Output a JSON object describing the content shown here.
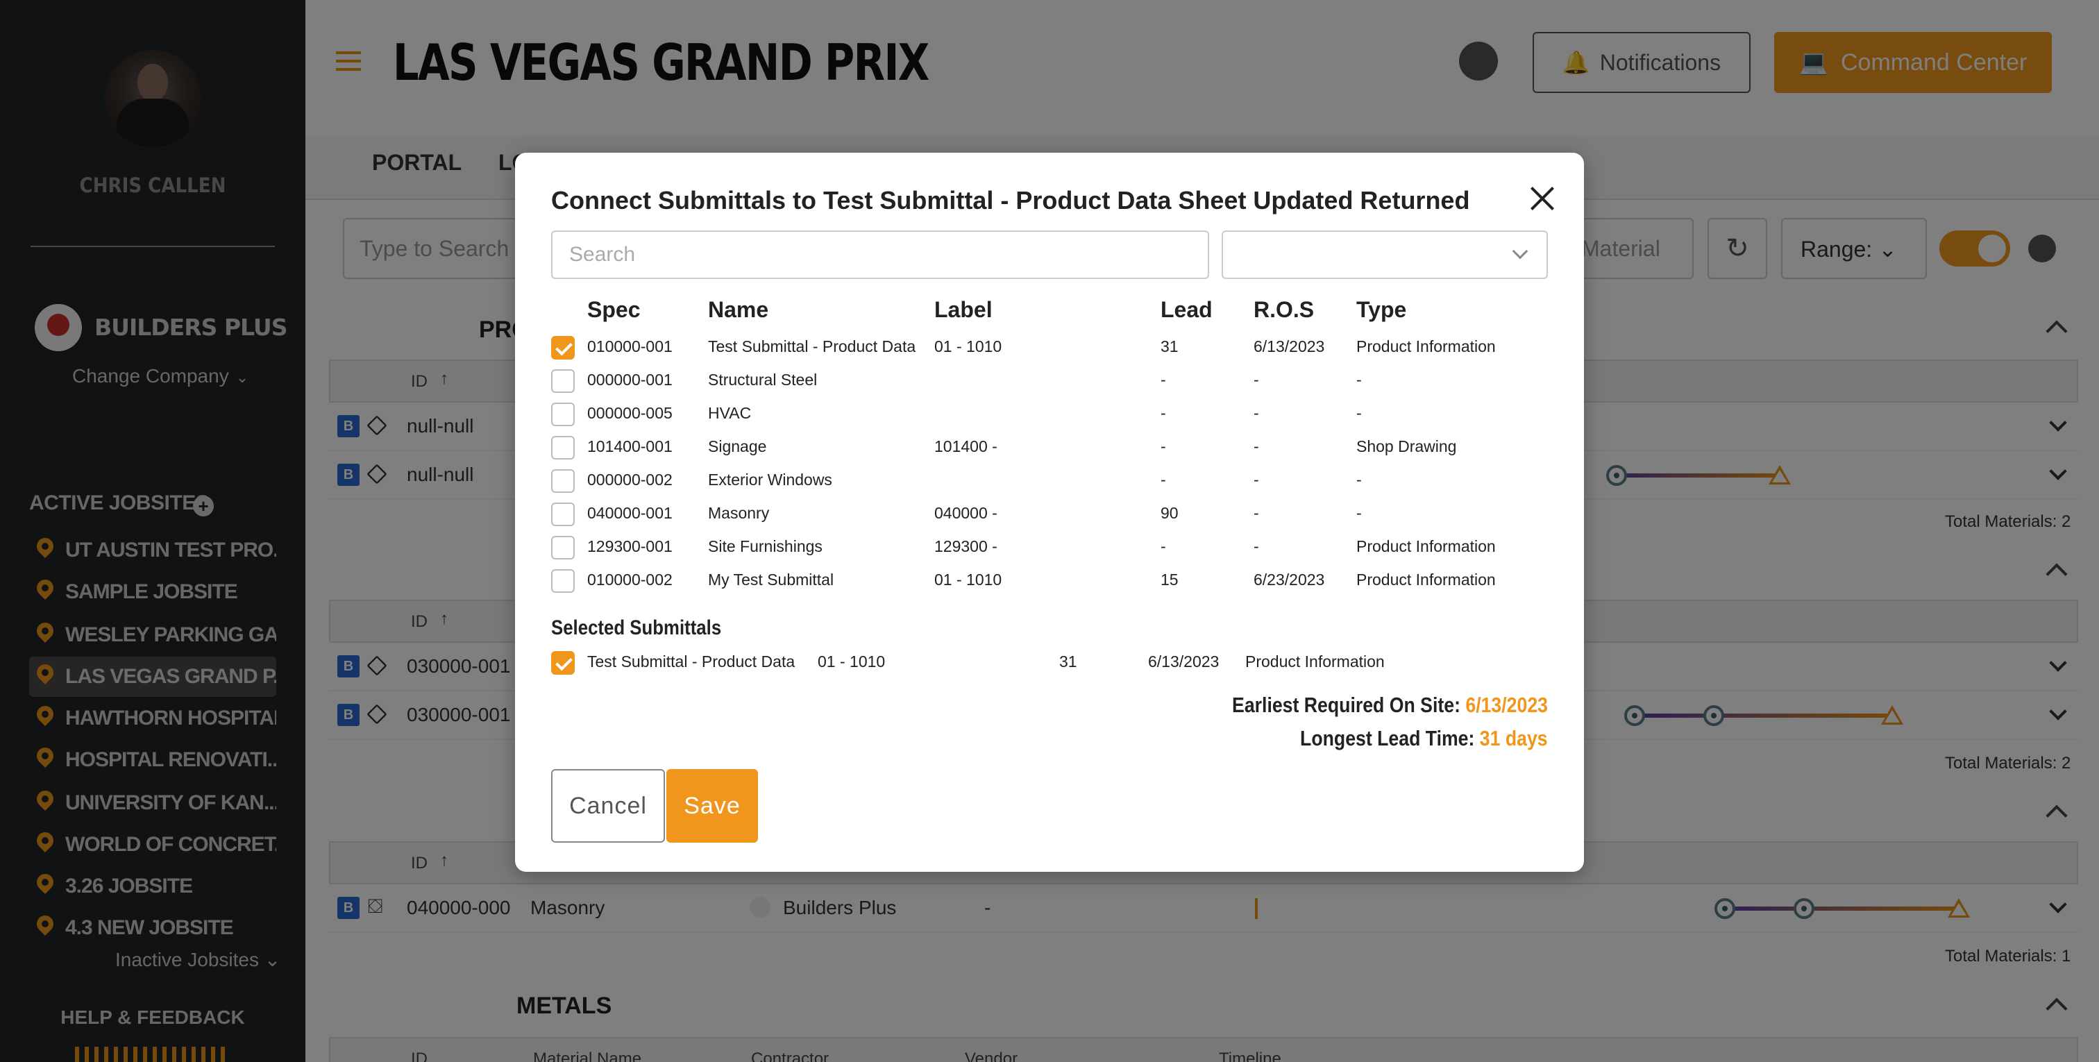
{
  "user": {
    "name": "CHRIS CALLEN"
  },
  "company": {
    "name": "BUILDERS PLUS",
    "change_label": "Change Company"
  },
  "sidebar": {
    "active_label": "ACTIVE JOBSITES",
    "jobsites": [
      "UT AUSTIN TEST PRO...",
      "SAMPLE JOBSITE",
      "WESLEY PARKING GA...",
      "LAS VEGAS GRAND P...",
      "HAWTHORN HOSPITAL",
      "HOSPITAL RENOVATI...",
      "UNIVERSITY OF KAN...",
      "WORLD OF CONCRET...",
      "3.26 JOBSITE",
      "4.3 NEW JOBSITE"
    ],
    "inactive_label": "Inactive Jobsites",
    "help_label": "HELP & FEEDBACK"
  },
  "header": {
    "title": "LAS VEGAS GRAND PRIX",
    "notifications_label": "Notifications",
    "command_center_label": "Command Center"
  },
  "tabs": [
    "PORTAL",
    "LO"
  ],
  "toolbar": {
    "search_placeholder": "Type to Search",
    "material_label": "Material",
    "range_label": "Range:"
  },
  "background": {
    "section_partial": "PRO",
    "id_header": "ID",
    "rows": {
      "r1": "null-null",
      "r2": "null-null",
      "r3": "030000-001",
      "r4": "030000-001",
      "r5_id": "040000-000",
      "r5_name": "Masonry",
      "r5_contractor": "Builders Plus",
      "r5_label": "-"
    },
    "totals": [
      "Total Materials: 2",
      "Total Materials: 2",
      "Total Materials: 1"
    ],
    "metals_section": "METALS",
    "metals_headers": [
      "ID",
      "Material Name",
      "Contractor",
      "Vendor",
      "Timeline"
    ]
  },
  "modal": {
    "title": "Connect Submittals to Test Submittal - Product Data Sheet Updated Returned",
    "search_placeholder": "Search",
    "columns": [
      "Spec",
      "Name",
      "Label",
      "Lead",
      "R.O.S",
      "Type"
    ],
    "rows": [
      {
        "checked": true,
        "spec": "010000-001",
        "name": "Test Submittal - Product Data",
        "label": "01 - 1010",
        "lead": "31",
        "ros": "6/13/2023",
        "type": "Product Information"
      },
      {
        "checked": false,
        "spec": "000000-001",
        "name": "Structural Steel",
        "label": "",
        "lead": "-",
        "ros": "-",
        "type": "-"
      },
      {
        "checked": false,
        "spec": "000000-005",
        "name": "HVAC",
        "label": "",
        "lead": "-",
        "ros": "-",
        "type": "-"
      },
      {
        "checked": false,
        "spec": "101400-001",
        "name": "Signage",
        "label": "101400 -",
        "lead": "-",
        "ros": "-",
        "type": "Shop Drawing"
      },
      {
        "checked": false,
        "spec": "000000-002",
        "name": "Exterior Windows",
        "label": "",
        "lead": "-",
        "ros": "-",
        "type": "-"
      },
      {
        "checked": false,
        "spec": "040000-001",
        "name": "Masonry",
        "label": "040000 -",
        "lead": "90",
        "ros": "-",
        "type": "-"
      },
      {
        "checked": false,
        "spec": "129300-001",
        "name": "Site Furnishings",
        "label": "129300 -",
        "lead": "-",
        "ros": "-",
        "type": "Product Information"
      },
      {
        "checked": false,
        "spec": "010000-002",
        "name": "My Test Submittal",
        "label": "01 - 1010",
        "lead": "15",
        "ros": "6/23/2023",
        "type": "Product Information"
      }
    ],
    "selected_title": "Selected Submittals",
    "selected": {
      "name": "Test Submittal - Product Data",
      "label": "01 - 1010",
      "lead": "31",
      "ros": "6/13/2023",
      "type": "Product Information"
    },
    "earliest_label": "Earliest Required On Site:",
    "earliest_value": "6/13/2023",
    "longest_label": "Longest Lead Time:",
    "longest_value": "31 days",
    "cancel_label": "Cancel",
    "save_label": "Save"
  },
  "colors": {
    "accent": "#f0961c",
    "sidebar_bg": "#222426",
    "badge_blue": "#2a6bd1"
  }
}
